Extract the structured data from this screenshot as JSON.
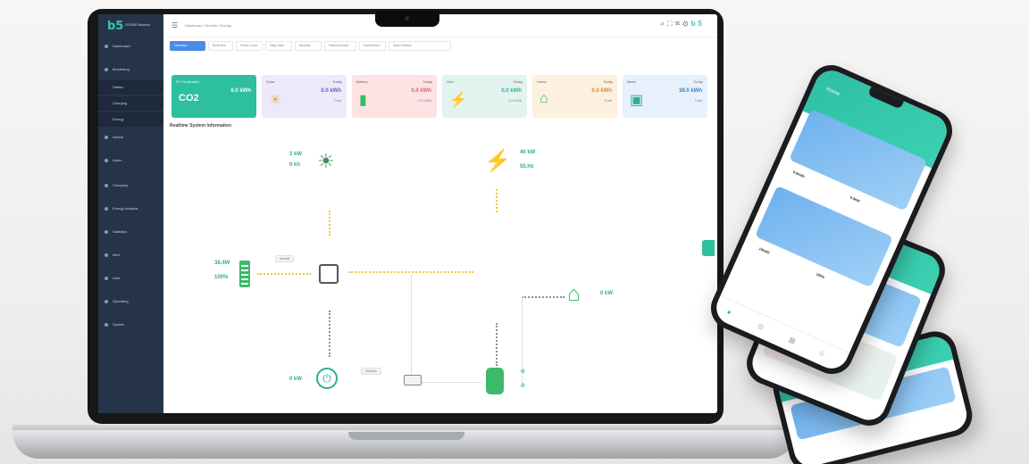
{
  "app": {
    "logo": "b5",
    "logo_sub": "SOFAR Monitor"
  },
  "sidebar": {
    "items": [
      {
        "label": "Dashboard"
      },
      {
        "label": "Monitoring"
      },
      {
        "label": "Station"
      },
      {
        "label": "Charging"
      },
      {
        "label": "Energy"
      },
      {
        "label": "Device"
      },
      {
        "label": "Alarm"
      },
      {
        "label": "Company"
      },
      {
        "label": "Energy Analysis"
      },
      {
        "label": "Statistics"
      },
      {
        "label": "Alert"
      },
      {
        "label": "User"
      },
      {
        "label": "Operating"
      },
      {
        "label": "System"
      }
    ]
  },
  "topbar": {
    "breadcrumb": "Dashboard / Monitor / Energy"
  },
  "tabs": [
    "Overview",
    "Real time",
    "Power curve",
    "Daily data",
    "Monthly",
    "Historical data",
    "Parameters",
    "Alarm history"
  ],
  "cards": [
    {
      "title": "PV Generation",
      "value": "0.0 kWh",
      "sub": "",
      "color": "#2dbf9f",
      "icon": "CO2"
    },
    {
      "title": "Solar",
      "cap": "Today",
      "value": "0.0 kWh",
      "sub": "Total",
      "color": "#ece9fb"
    },
    {
      "title": "Battery",
      "cap": "Today",
      "value": "0.0 kWh",
      "sub": "0.0 kWh",
      "color": "#fde3e3"
    },
    {
      "title": "Grid",
      "cap": "Today",
      "value": "0.0 kWh",
      "sub": "0.0 kWh",
      "color": "#e2f4ef"
    },
    {
      "title": "Home",
      "cap": "Today",
      "value": "0.0 kWh",
      "sub": "Total",
      "color": "#fdf0de"
    },
    {
      "title": "Meter",
      "cap": "Today",
      "value": "38.0 kWh",
      "sub": "Total",
      "color": "#e6f1fb"
    }
  ],
  "section_title": "Realtime System Information",
  "flow": {
    "pv": {
      "v1": "2 kW",
      "v2": "0 kh"
    },
    "grid": {
      "v1": "40 kW",
      "v2": "50.Hz"
    },
    "battery": {
      "v1": "38.4W",
      "v2": "100%"
    },
    "home": {
      "v1": "0 kW"
    },
    "ev": {
      "v1": "0 kW"
    },
    "charger": {
      "v1": "-0",
      "v2": "-0"
    },
    "pill1": "Normal",
    "pill2": "Standby"
  },
  "phone": {
    "title": "Home",
    "stats": [
      "0.0kWh",
      "0.0kW",
      "10kWh",
      "100%"
    ]
  },
  "colors": {
    "accent": "#2dbf9f",
    "sidebar": "#263449",
    "tab_active": "#4a8be8"
  }
}
